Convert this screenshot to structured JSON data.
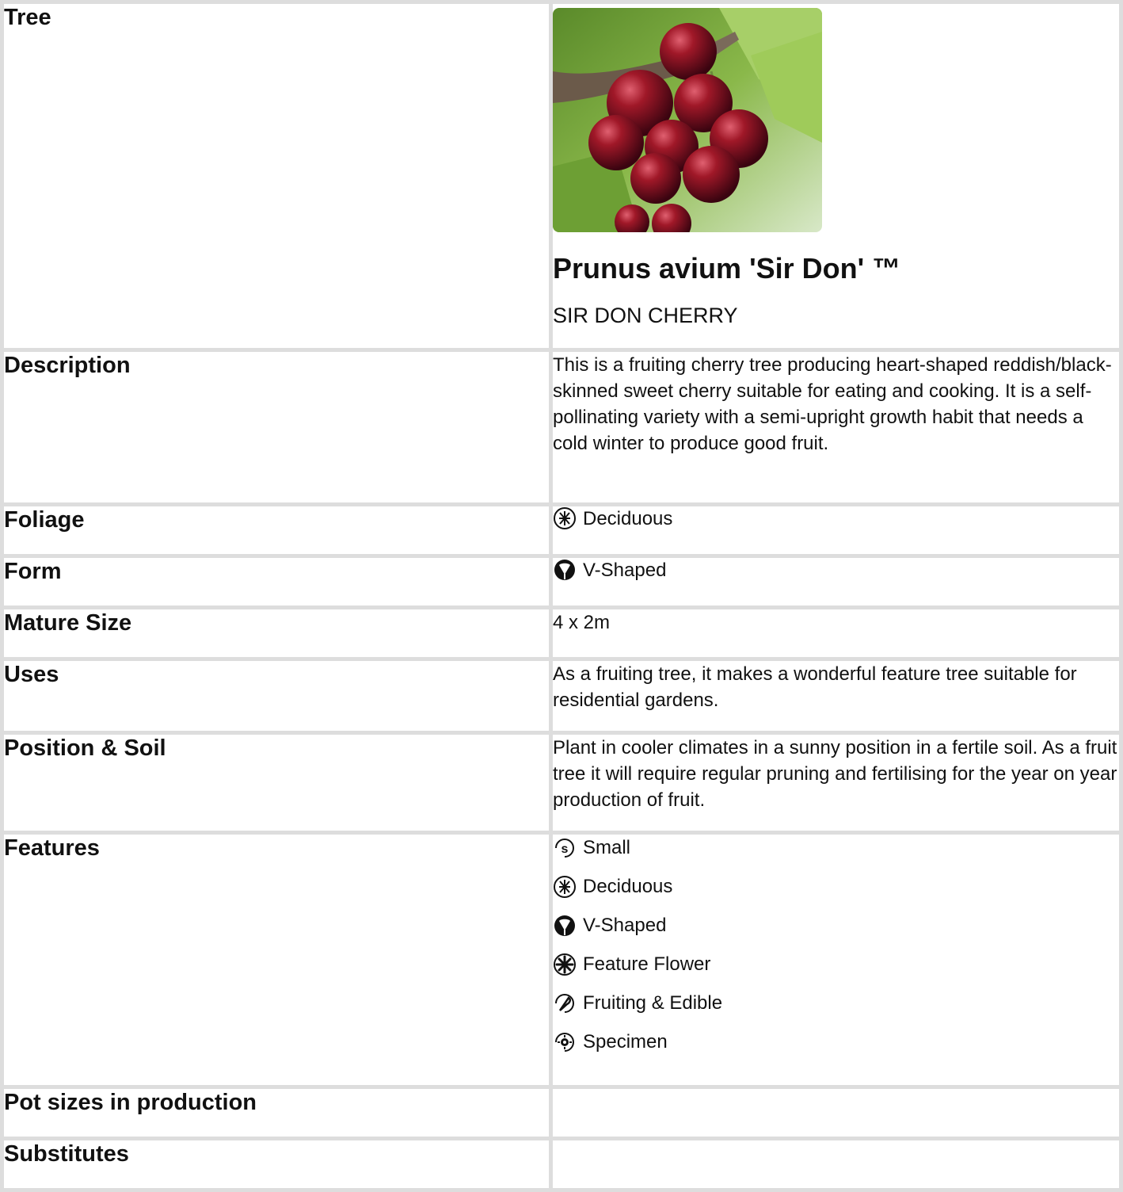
{
  "header": {
    "label": "Tree",
    "botanical_name": "Prunus avium 'Sir Don' ™",
    "common_name": "SIR DON CHERRY",
    "image_subject": "red cherries on branch"
  },
  "rows": {
    "description": {
      "label": "Description",
      "value": "This is a fruiting cherry tree producing heart-shaped reddish/black-skinned sweet cherry suitable for eating and cooking. It is a self-pollinating variety with a semi-upright growth habit that needs a cold winter to produce good fruit."
    },
    "foliage": {
      "label": "Foliage",
      "value": "Deciduous",
      "icon": "deciduous-icon"
    },
    "form": {
      "label": "Form",
      "value": "V-Shaped",
      "icon": "v-shaped-icon"
    },
    "mature_size": {
      "label": "Mature Size",
      "value": "4 x 2m"
    },
    "uses": {
      "label": "Uses",
      "value": "As a fruiting tree, it makes a wonderful feature tree suitable for residential gardens."
    },
    "position_soil": {
      "label": "Position & Soil",
      "value": "Plant in cooler climates in a sunny position in a fertile soil. As a fruit tree it will require regular pruning and fertilising for the year on year production of fruit."
    },
    "features": {
      "label": "Features",
      "items": [
        {
          "text": "Small",
          "icon": "small-icon"
        },
        {
          "text": "Deciduous",
          "icon": "deciduous-icon"
        },
        {
          "text": "V-Shaped",
          "icon": "v-shaped-icon"
        },
        {
          "text": "Feature Flower",
          "icon": "feature-flower-icon"
        },
        {
          "text": "Fruiting & Edible",
          "icon": "fruiting-edible-icon"
        },
        {
          "text": "Specimen",
          "icon": "specimen-icon"
        }
      ]
    },
    "pot_sizes": {
      "label": "Pot sizes in production",
      "value": ""
    },
    "substitutes": {
      "label": "Substitutes",
      "value": ""
    }
  }
}
